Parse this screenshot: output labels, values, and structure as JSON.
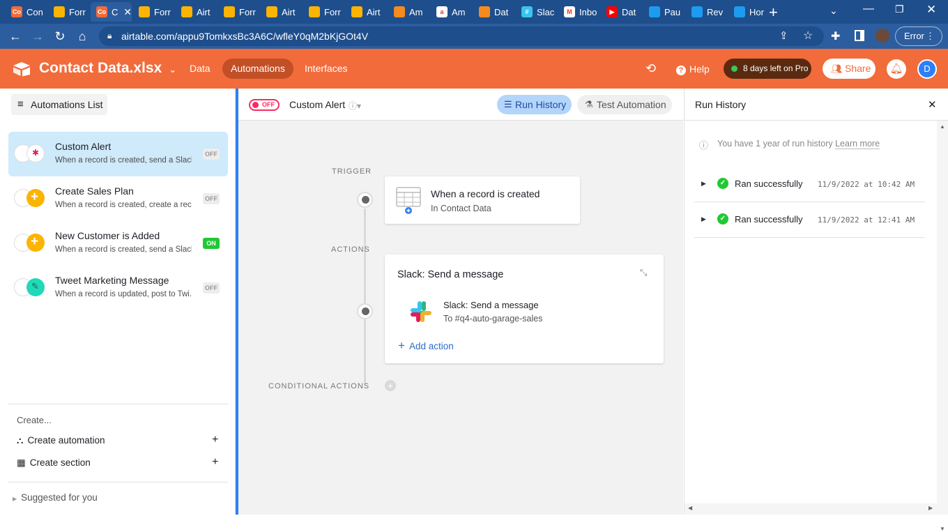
{
  "browser": {
    "tabs": [
      {
        "label": "Con",
        "icon": "co-icon",
        "color": "#f26b3a",
        "glyph": "Co"
      },
      {
        "label": "Forr",
        "icon": "airtable-icon",
        "color": "#fcb400",
        "glyph": ""
      },
      {
        "label": "C",
        "icon": "co-icon",
        "color": "#f26b3a",
        "glyph": "Co"
      },
      {
        "label": "Forr",
        "icon": "airtable-icon",
        "color": "#fcb400",
        "glyph": ""
      },
      {
        "label": "Airt",
        "icon": "airtable-icon",
        "color": "#fcb400",
        "glyph": ""
      },
      {
        "label": "Forr",
        "icon": "airtable-icon",
        "color": "#fcb400",
        "glyph": ""
      },
      {
        "label": "Airt",
        "icon": "airtable-icon",
        "color": "#fcb400",
        "glyph": ""
      },
      {
        "label": "Forr",
        "icon": "airtable-icon",
        "color": "#fcb400",
        "glyph": ""
      },
      {
        "label": "Airt",
        "icon": "airtable-icon",
        "color": "#fcb400",
        "glyph": ""
      },
      {
        "label": "Am",
        "icon": "box-icon",
        "color": "#f58a1f",
        "glyph": ""
      },
      {
        "label": "Am",
        "icon": "amazon-icon",
        "color": "#ffffff",
        "glyph": "a"
      },
      {
        "label": "Dat",
        "icon": "box-icon",
        "color": "#f58a1f",
        "glyph": ""
      },
      {
        "label": "Slac",
        "icon": "slack-icon",
        "color": "#36c5f0",
        "glyph": "#"
      },
      {
        "label": "Inbo",
        "icon": "gmail-icon",
        "color": "#ffffff",
        "glyph": "M"
      },
      {
        "label": "Dat",
        "icon": "youtube-icon",
        "color": "#ff0000",
        "glyph": "▶"
      },
      {
        "label": "Pau",
        "icon": "twitter-icon",
        "color": "#1d9bf0",
        "glyph": ""
      },
      {
        "label": "Rev",
        "icon": "twitter-icon",
        "color": "#1d9bf0",
        "glyph": ""
      },
      {
        "label": "Hor",
        "icon": "twitter-icon",
        "color": "#1d9bf0",
        "glyph": ""
      }
    ],
    "active_tab": 2,
    "url": "airtable.com/appu9TomkxsBc3A6C/wfleY0qM2bKjGOt4V",
    "error_label": "Error"
  },
  "app": {
    "base_name": "Contact Data.xlsx",
    "nav": [
      {
        "label": "Data",
        "selected": false
      },
      {
        "label": "Automations",
        "selected": true
      },
      {
        "label": "Interfaces",
        "selected": false
      }
    ],
    "help_label": "Help",
    "trial_label": "8 days left on Pro",
    "share_label": "Share",
    "avatar_initial": "D",
    "header_color": "#f26b3a"
  },
  "sidebar": {
    "list_button": "Automations List",
    "automations": [
      {
        "title": "Custom Alert",
        "desc": "When a record is created, send a Slack...",
        "status": "OFF",
        "selected": true,
        "icon2_color": "#ffffff"
      },
      {
        "title": "Create Sales Plan",
        "desc": "When a record is created, create a rec...",
        "status": "OFF",
        "selected": false,
        "icon2_color": "#fcb400"
      },
      {
        "title": "New Customer is Added",
        "desc": "When a record is created, send a Slack...",
        "status": "ON",
        "selected": false,
        "icon2_color": "#fcb400"
      },
      {
        "title": "Tweet Marketing Message",
        "desc": "When a record is updated, post to Twi...",
        "status": "OFF",
        "selected": false,
        "icon2_color": "#20d9b8"
      }
    ],
    "create_label": "Create...",
    "create_automation": "Create automation",
    "create_section": "Create section",
    "suggested": "Suggested for you"
  },
  "editor": {
    "toggle_label": "OFF",
    "automation_name": "Custom Alert",
    "run_history_btn": "Run History",
    "test_btn": "Test Automation",
    "trigger_label": "TRIGGER",
    "trigger_title": "When a record is created",
    "trigger_sub": "In Contact Data",
    "actions_label": "ACTIONS",
    "action_card_title": "Slack: Send a message",
    "action_item_title": "Slack: Send a message",
    "action_item_sub": "To #q4-auto-garage-sales",
    "add_action": "Add action",
    "conditional_label": "CONDITIONAL ACTIONS"
  },
  "run_history": {
    "title": "Run History",
    "info": "You have 1 year of run history",
    "learn_more": "Learn more",
    "runs": [
      {
        "status": "Ran successfully",
        "time": "11/9/2022 at 10:42 AM"
      },
      {
        "status": "Ran successfully",
        "time": "11/9/2022 at 12:41 AM"
      }
    ]
  }
}
